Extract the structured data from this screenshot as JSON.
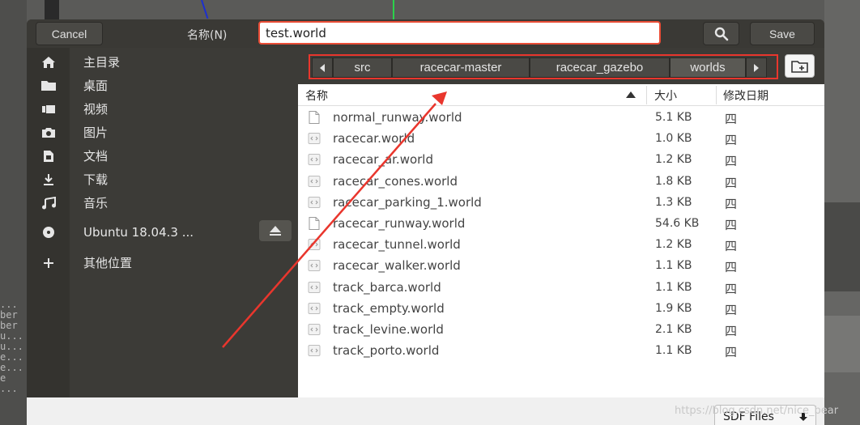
{
  "header": {
    "cancel_label": "Cancel",
    "name_label": "名称(N)",
    "filename_value": "test.world",
    "save_label": "Save"
  },
  "sidebar": {
    "items": [
      {
        "label": "主目录",
        "icon": "home-icon"
      },
      {
        "label": "桌面",
        "icon": "folder-icon"
      },
      {
        "label": "视频",
        "icon": "video-icon"
      },
      {
        "label": "图片",
        "icon": "camera-icon"
      },
      {
        "label": "文档",
        "icon": "document-icon"
      },
      {
        "label": "下载",
        "icon": "download-icon"
      },
      {
        "label": "音乐",
        "icon": "music-icon"
      },
      {
        "label": "Ubuntu 18.04.3 ...",
        "icon": "disc-icon"
      },
      {
        "label": "其他位置",
        "icon": "plus-icon"
      }
    ]
  },
  "pathbar": {
    "crumbs": [
      "src",
      "racecar-master",
      "racecar_gazebo",
      "worlds"
    ],
    "active_index": 3
  },
  "filelist": {
    "columns": {
      "name": "名称",
      "size": "大小",
      "date": "修改日期"
    },
    "rows": [
      {
        "name": "normal_runway.world",
        "size": "5.1 KB",
        "date": "四",
        "icon": "plain-file-icon"
      },
      {
        "name": "racecar.world",
        "size": "1.0 KB",
        "date": "四",
        "icon": "code-file-icon"
      },
      {
        "name": "racecar_ar.world",
        "size": "1.2 KB",
        "date": "四",
        "icon": "code-file-icon"
      },
      {
        "name": "racecar_cones.world",
        "size": "1.8 KB",
        "date": "四",
        "icon": "code-file-icon"
      },
      {
        "name": "racecar_parking_1.world",
        "size": "1.3 KB",
        "date": "四",
        "icon": "code-file-icon"
      },
      {
        "name": "racecar_runway.world",
        "size": "54.6 KB",
        "date": "四",
        "icon": "plain-file-icon"
      },
      {
        "name": "racecar_tunnel.world",
        "size": "1.2 KB",
        "date": "四",
        "icon": "code-file-icon"
      },
      {
        "name": "racecar_walker.world",
        "size": "1.1 KB",
        "date": "四",
        "icon": "code-file-icon"
      },
      {
        "name": "track_barca.world",
        "size": "1.1 KB",
        "date": "四",
        "icon": "code-file-icon"
      },
      {
        "name": "track_empty.world",
        "size": "1.9 KB",
        "date": "四",
        "icon": "code-file-icon"
      },
      {
        "name": "track_levine.world",
        "size": "2.1 KB",
        "date": "四",
        "icon": "code-file-icon"
      },
      {
        "name": "track_porto.world",
        "size": "1.1 KB",
        "date": "四",
        "icon": "code-file-icon"
      }
    ]
  },
  "filter": {
    "selected": "SDF Files"
  },
  "watermark": "https://blog.csdn.net/nice_bear",
  "background_text": "...\nber\nber\nu...\nu...\ne...\ne...\ne\n...",
  "colors": {
    "highlight_border": "#e9362d",
    "arrow": "#e9362d"
  }
}
